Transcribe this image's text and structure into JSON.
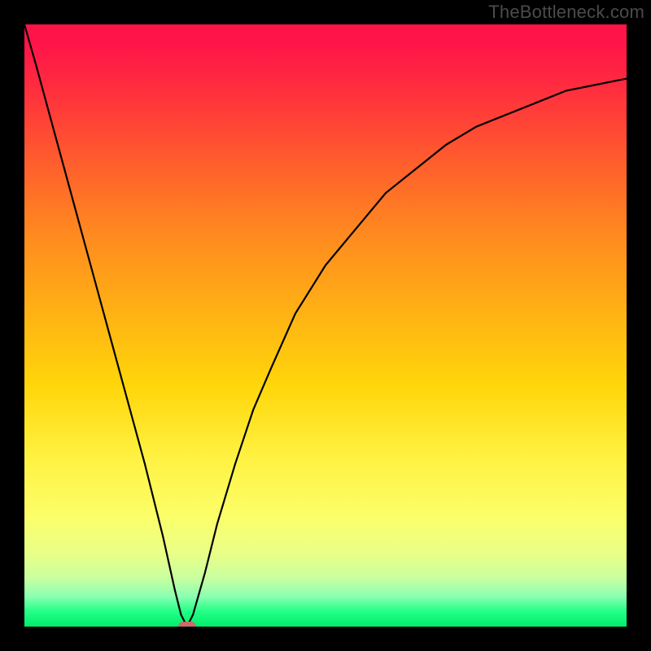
{
  "watermark": "TheBottleneck.com",
  "chart_data": {
    "type": "line",
    "title": "",
    "xlabel": "",
    "ylabel": "",
    "xlim": [
      0,
      100
    ],
    "ylim": [
      0,
      100
    ],
    "grid": false,
    "legend": false,
    "series": [
      {
        "name": "curve",
        "x": [
          0,
          2,
          5,
          8,
          11,
          14,
          17,
          20,
          23,
          25,
          26,
          27,
          28,
          30,
          32,
          35,
          38,
          41,
          45,
          50,
          55,
          60,
          65,
          70,
          75,
          80,
          85,
          90,
          95,
          100
        ],
        "y": [
          100,
          93,
          82,
          71,
          60,
          49,
          38,
          27,
          15,
          6,
          2,
          0,
          2,
          9,
          17,
          27,
          36,
          43,
          52,
          60,
          66,
          72,
          76,
          80,
          83,
          85,
          87,
          89,
          90,
          91
        ]
      }
    ],
    "marker": {
      "x": 27,
      "y": 0,
      "color": "#c96b6b"
    }
  },
  "colors": {
    "frame": "#000000",
    "watermark": "#4b4b4b",
    "marker": "#c96b6b",
    "curve": "#000000"
  }
}
